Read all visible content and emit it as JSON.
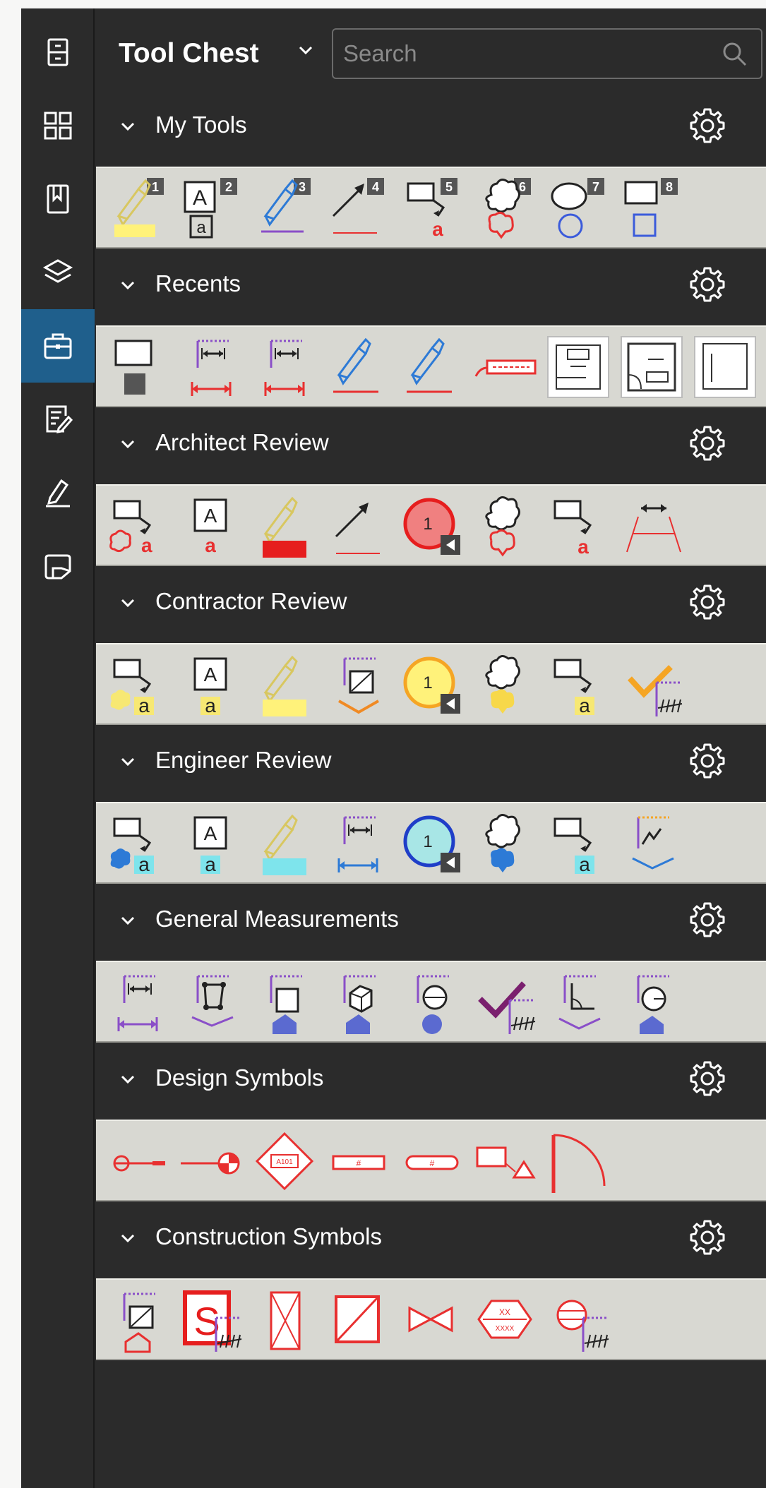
{
  "header": {
    "title": "Tool Chest",
    "search_placeholder": "Search"
  },
  "rail": [
    {
      "icon": "file-cabinet-icon",
      "active": false
    },
    {
      "icon": "thumbnails-icon",
      "active": false
    },
    {
      "icon": "bookmark-icon",
      "active": false
    },
    {
      "icon": "layers-icon",
      "active": false
    },
    {
      "icon": "toolbox-icon",
      "active": true
    },
    {
      "icon": "markups-list-icon",
      "active": false
    },
    {
      "icon": "signature-icon",
      "active": false
    },
    {
      "icon": "spaces-icon",
      "active": false
    }
  ],
  "sections": [
    {
      "title": "My Tools",
      "numbers": [
        "1",
        "2",
        "3",
        "4",
        "5",
        "6",
        "7",
        "8"
      ]
    },
    {
      "title": "Recents"
    },
    {
      "title": "Architect Review",
      "badge": "1"
    },
    {
      "title": "Contractor Review",
      "badge": "1"
    },
    {
      "title": "Engineer Review",
      "badge": "1"
    },
    {
      "title": "General Measurements"
    },
    {
      "title": "Design Symbols"
    },
    {
      "title": "Construction Symbols"
    }
  ],
  "colors": {
    "background": "#2b2b2b",
    "tray": "#d8d8d2",
    "active_rail": "#1f5f8c",
    "architect": "#e83030",
    "contractor": "#f7e873",
    "engineer": "#7ee4ec",
    "measurement": "#8a4fc8"
  }
}
